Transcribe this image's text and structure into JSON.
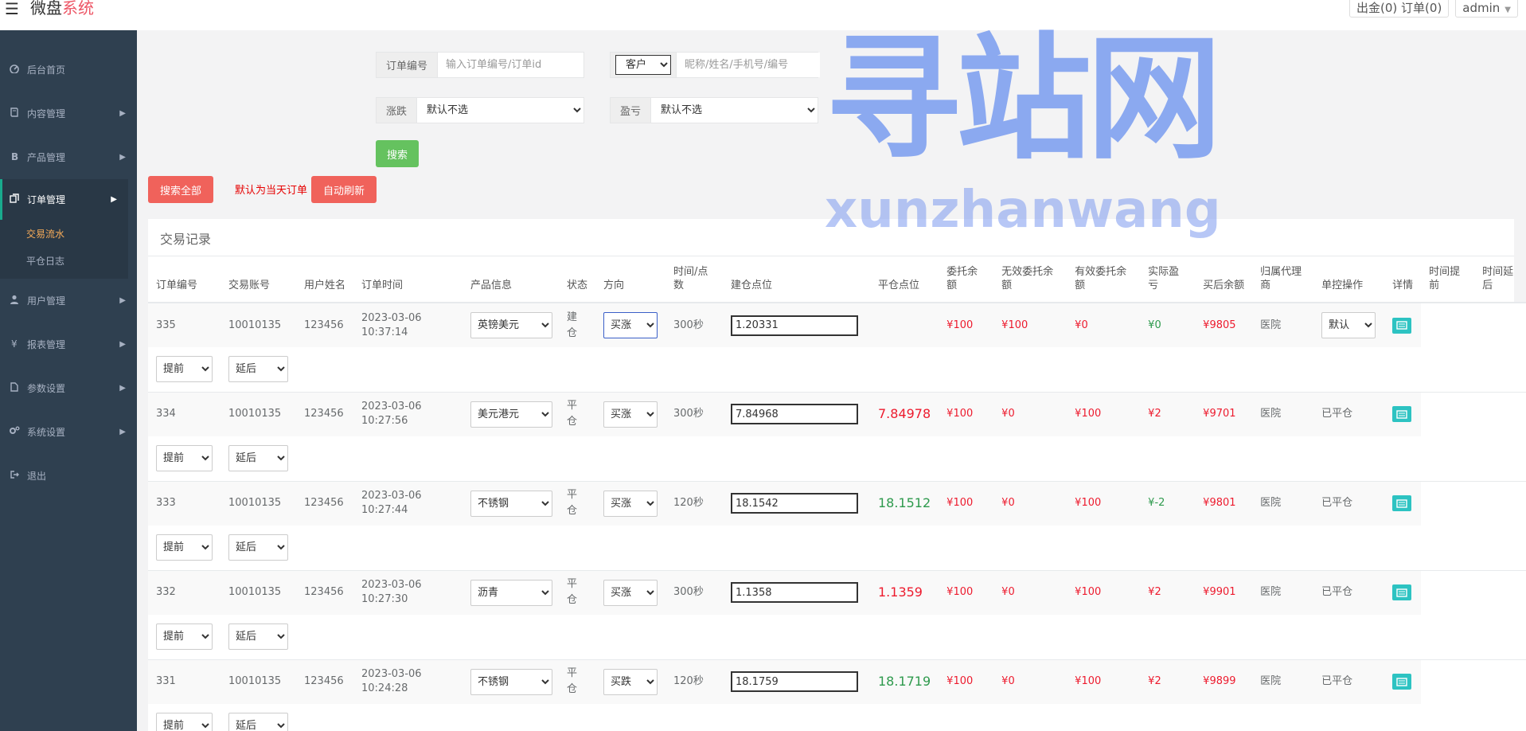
{
  "header": {
    "brand_main": "微盘",
    "brand_accent": "系统",
    "withdraw": "出金(0) 订单(0)",
    "user": "admin"
  },
  "sidebar": {
    "items": [
      {
        "label": "后台首页",
        "icon": "dashboard-icon"
      },
      {
        "label": "内容管理",
        "icon": "book-icon"
      },
      {
        "label": "产品管理",
        "icon": "bitcoin-icon"
      },
      {
        "label": "订单管理",
        "icon": "copy-icon"
      },
      {
        "label": "用户管理",
        "icon": "user-icon"
      },
      {
        "label": "报表管理",
        "icon": "yen-icon"
      },
      {
        "label": "参数设置",
        "icon": "file-icon"
      },
      {
        "label": "系统设置",
        "icon": "gears-icon"
      },
      {
        "label": "退出",
        "icon": "logout-icon"
      }
    ],
    "sub": [
      "交易流水",
      "平仓日志"
    ]
  },
  "filters": {
    "order_label": "订单编号",
    "order_placeholder": "输入订单编号/订单id",
    "customer_select": "客户",
    "customer_placeholder": "昵称/姓名/手机号/编号",
    "rise_label": "涨跌",
    "rise_value": "默认不选",
    "pl_label": "盈亏",
    "pl_value": "默认不选",
    "search": "搜索",
    "search_all": "搜索全部",
    "default_hint": "默认为当天订单",
    "auto_refresh": "自动刷新"
  },
  "watermark": {
    "zh": "寻站网",
    "en": "xunzhanwang"
  },
  "panel_title": "交易记录",
  "columns": [
    "订单编号",
    "交易账号",
    "用户姓名",
    "订单时间",
    "产品信息",
    "状态",
    "方向",
    "时间/点数",
    "建仓点位",
    "平仓点位",
    "委托余额",
    "无效委托余额",
    "有效委托余额",
    "实际盈亏",
    "买后余额",
    "归属代理商",
    "单控操作",
    "详情",
    "时间提前",
    "时间延后"
  ],
  "rows": [
    {
      "id": "335",
      "account": "10010135",
      "name": "123456",
      "date": "2023-03-06",
      "time": "10:37:14",
      "product": "英镑美元",
      "status": "建仓",
      "direction": "买涨",
      "period": "300秒",
      "open": "1.20331",
      "close": "",
      "close_color": "",
      "entrust": "¥100",
      "invalid": "¥100",
      "valid": "¥0",
      "pl": "¥0",
      "pl_color": "green",
      "after": "¥9805",
      "agent": "医院",
      "control": "默认",
      "ahead": "提前",
      "delay": "延后"
    },
    {
      "id": "334",
      "account": "10010135",
      "name": "123456",
      "date": "2023-03-06",
      "time": "10:27:56",
      "product": "美元港元",
      "status": "平仓",
      "direction": "买涨",
      "period": "300秒",
      "open": "7.84968",
      "close": "7.84978",
      "close_color": "red",
      "entrust": "¥100",
      "invalid": "¥0",
      "valid": "¥100",
      "pl": "¥2",
      "pl_color": "red",
      "after": "¥9701",
      "agent": "医院",
      "control": "已平仓",
      "ahead": "提前",
      "delay": "延后"
    },
    {
      "id": "333",
      "account": "10010135",
      "name": "123456",
      "date": "2023-03-06",
      "time": "10:27:44",
      "product": "不锈钢",
      "status": "平仓",
      "direction": "买涨",
      "period": "120秒",
      "open": "18.1542",
      "close": "18.1512",
      "close_color": "green",
      "entrust": "¥100",
      "invalid": "¥0",
      "valid": "¥100",
      "pl": "¥-2",
      "pl_color": "green",
      "after": "¥9801",
      "agent": "医院",
      "control": "已平仓",
      "ahead": "提前",
      "delay": "延后"
    },
    {
      "id": "332",
      "account": "10010135",
      "name": "123456",
      "date": "2023-03-06",
      "time": "10:27:30",
      "product": "沥青",
      "status": "平仓",
      "direction": "买涨",
      "period": "300秒",
      "open": "1.1358",
      "close": "1.1359",
      "close_color": "red",
      "entrust": "¥100",
      "invalid": "¥0",
      "valid": "¥100",
      "pl": "¥2",
      "pl_color": "red",
      "after": "¥9901",
      "agent": "医院",
      "control": "已平仓",
      "ahead": "提前",
      "delay": "延后"
    },
    {
      "id": "331",
      "account": "10010135",
      "name": "123456",
      "date": "2023-03-06",
      "time": "10:24:28",
      "product": "不锈钢",
      "status": "平仓",
      "direction": "买跌",
      "period": "120秒",
      "open": "18.1759",
      "close": "18.1719",
      "close_color": "green",
      "entrust": "¥100",
      "invalid": "¥0",
      "valid": "¥100",
      "pl": "¥2",
      "pl_color": "red",
      "after": "¥9899",
      "agent": "医院",
      "control": "已平仓",
      "ahead": "提前",
      "delay": "延后"
    }
  ]
}
